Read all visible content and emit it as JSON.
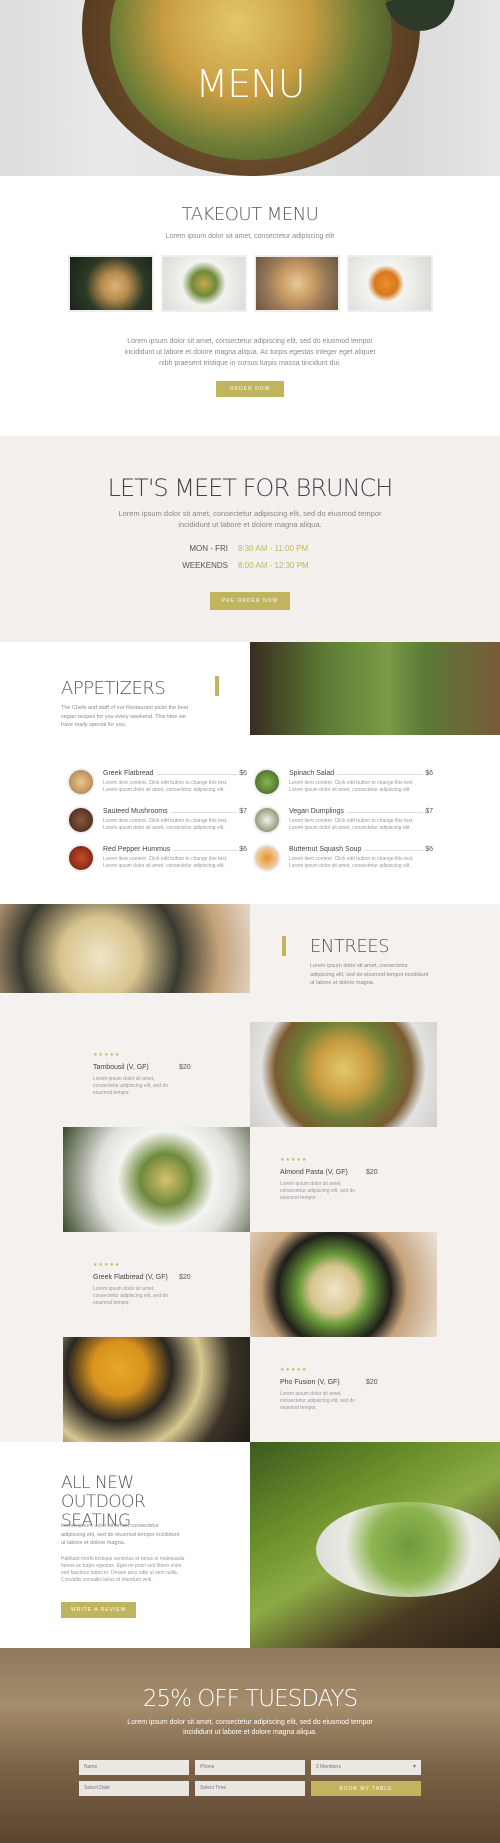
{
  "hero": {
    "title": "MENU"
  },
  "takeout": {
    "title": "TAKEOUT MENU",
    "subtitle": "Lorem ipsum dolor sit amet, consectetur adipiscing elit",
    "body": "Lorem ipsum dolor sit amet, consectetur adipiscing elit, sed do eiusmod tempor incididunt ut labore et dolore magna aliqua. Ac turpis egestas integer eget aliquet nibh praesent tristique in cursus turpis massa tincidunt dui.",
    "button": "ORDER NOW"
  },
  "brunch": {
    "title": "LET'S MEET FOR BRUNCH",
    "body": "Lorem ipsum dolor sit amet, consectetur adipiscing elit, sed do eiusmod tempor incididunt ut labore et dolore magna aliqua.",
    "hours": [
      {
        "days": "MON - FRI",
        "time": "9:30 AM - 11:00 PM"
      },
      {
        "days": "WEEKENDS",
        "time": "8:00 AM - 12:30 PM"
      }
    ],
    "button": "PRE ORDER NOW"
  },
  "appetizers": {
    "title": "APPETIZERS",
    "intro": "The Chefs and staff of our Restaurant picks the best vegan recipes for you every weekend. This time we have really special for you.",
    "item_desc": "Lorem item content. Click edit button to change this text. Lorem ipsum dolor sit amet, consectetur adipiscing elit.",
    "items": [
      {
        "name": "Greek Flatbread",
        "price": "$6"
      },
      {
        "name": "Spinach Salad",
        "price": "$6"
      },
      {
        "name": "Sauteed Mushrooms",
        "price": "$7"
      },
      {
        "name": "Vegan Dumplings",
        "price": "$7"
      },
      {
        "name": "Red Pepper Hummus",
        "price": "$6"
      },
      {
        "name": "Butternut Squash Soup",
        "price": "$6"
      }
    ]
  },
  "entrees": {
    "title": "ENTREES",
    "intro": "Lorem ipsum dolor sit amet, consectetur adipiscing elit, sed do eiusmod tempor incididunt ut labore et dolore magna.",
    "stars": "★★★★★",
    "desc": "Lorem ipsum dolor sit amet, consectetur adipiscing elit, sed do eiusmod tempor.",
    "items": [
      {
        "name": "Tambousil (V, GF)",
        "price": "$20"
      },
      {
        "name": "Almond Pasta (V, GF)",
        "price": "$20"
      },
      {
        "name": "Greek Flatbread (V, GF)",
        "price": "$20"
      },
      {
        "name": "Pho Fusion (V, GF)",
        "price": "$20"
      }
    ]
  },
  "outdoor": {
    "title": "ALL NEW OUTDOOR SEATING",
    "p1": "Lorem ipsum dolor sit amet, consectetur adipiscing elit, sed do eiusmod tempor incididunt ut labore et dolore magna.",
    "p2": "Habitant morbi tristique senectus et netus et malesuada fames ac turpis egestas. Eget mi proin sed libero enim sed faucibus turpis in. Ornare arcu odio ut sem nulla. Convallis convallis tellus id interdum velit.",
    "button": "WRITE A REVIEW"
  },
  "tuesdays": {
    "title": "25% OFF TUESDAYS",
    "body": "Lorem ipsum dolor sit amet, consectetur adipiscing elit, sed do eiusmod tempor incididunt ut labore et dolore magna aliqua.",
    "name_placeholder": "Name",
    "phone_placeholder": "Phone",
    "members": "2 Members",
    "date_placeholder": "Select Date",
    "time_placeholder": "Select Time",
    "button": "BOOK MY TABLE"
  },
  "colors": {
    "accent": "#c0b55e",
    "entrees_bg": "#f5f1ee"
  }
}
